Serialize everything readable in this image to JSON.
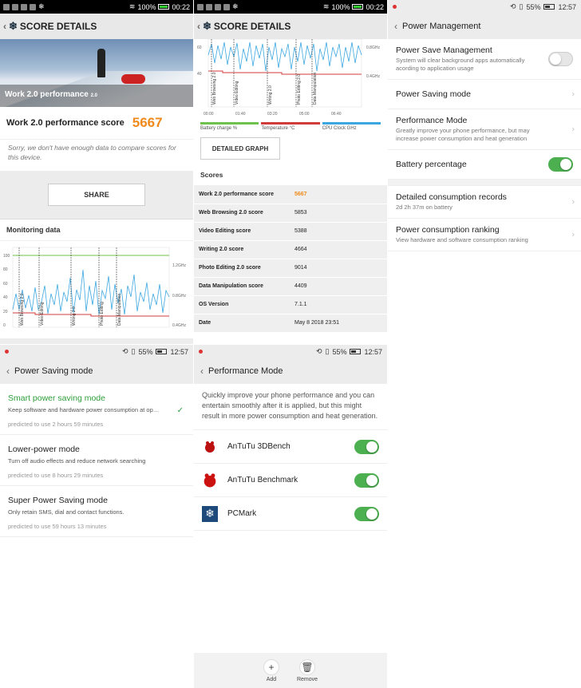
{
  "status_dark": {
    "battery": "100%",
    "time": "00:22"
  },
  "status_light": {
    "battery": "55%",
    "time": "12:57"
  },
  "score_details": {
    "title": "SCORE DETAILS",
    "hero_label": "Work 2.0 performance",
    "hero_label_sub": "2.0",
    "score_label": "Work 2.0 performance score",
    "score_value": "5667",
    "sorry_text": "Sorry, we don't have enough data to compare scores for this device.",
    "share_label": "SHARE",
    "monitoring_title": "Monitoring data",
    "chart_axis_left": [
      "100",
      "80",
      "60",
      "40",
      "20",
      "0"
    ],
    "chart_axis_right": [
      "1.2GHz",
      "0.8GHz",
      "0.4GHz"
    ],
    "chart_markers": [
      "Web Browsing 2.0",
      "Video Editing",
      "Writing 2.0",
      "Photo Editing",
      "Data Manipulation"
    ]
  },
  "score_details2": {
    "title": "SCORE DETAILS",
    "axis_right": [
      "0.8GHz",
      "0.4GHz"
    ],
    "axis_left": [
      "60",
      "40"
    ],
    "markers": [
      "Web Browsing 2.0",
      "Video Editing",
      "Writing 2.0",
      "Photo Editing 2.0",
      "Data Manipulation"
    ],
    "time_ticks": [
      "00:00",
      "01:40",
      "03:20",
      "05:00",
      "06:40"
    ],
    "legend": [
      "Battery charge %",
      "Temperature °C",
      "CPU Clock GHz"
    ],
    "legend_colors": [
      "#6cc24a",
      "#d33b3b",
      "#3ba6e0"
    ],
    "detailed_graph_label": "DETAILED GRAPH",
    "scores_title": "Scores",
    "rows": [
      {
        "k": "Work 2.0 performance score",
        "v": "5667"
      },
      {
        "k": "Web Browsing 2.0 score",
        "v": "5853"
      },
      {
        "k": "Video Editing score",
        "v": "5388"
      },
      {
        "k": "Writing 2.0 score",
        "v": "4664"
      },
      {
        "k": "Photo Editing 2.0 score",
        "v": "9014"
      },
      {
        "k": "Data Manipulation score",
        "v": "4409"
      },
      {
        "k": "OS Version",
        "v": "7.1.1"
      },
      {
        "k": "Date",
        "v": "May 8 2018 23:51"
      }
    ]
  },
  "power_management": {
    "title": "Power Management",
    "items": [
      {
        "title": "Power Save Management",
        "desc": "System will clear background apps automatically acording to application usage"
      },
      {
        "title": "Power Saving mode"
      },
      {
        "title": "Performance Mode",
        "desc": "Greatly improve your phone performance, but may increase power consumption and heat generation"
      },
      {
        "title": "Battery percentage"
      },
      {
        "title": "Detailed consumption records",
        "desc": "2d 2h 37m on battery"
      },
      {
        "title": "Power consumption ranking",
        "desc": "View hardware and software consumption ranking"
      }
    ]
  },
  "power_saving_mode": {
    "title": "Power Saving mode",
    "modes": [
      {
        "title": "Smart power saving mode",
        "desc": "Keep software and hardware power consumption at optimal levels",
        "pred": "predicted to use 2 hours 59 minutes"
      },
      {
        "title": "Lower-power mode",
        "desc": "Turn off audio effects and reduce network searching",
        "pred": "predicted to use 8 hours 29 minutes"
      },
      {
        "title": "Super Power Saving mode",
        "desc": "Only retain SMS, dial and contact functions.",
        "pred": "predicted to use 59 hours 13 minutes"
      }
    ]
  },
  "performance_mode": {
    "title": "Performance Mode",
    "desc": "Quickly improve your phone performance and you can entertain smoothly after it is applied, but this might result in more power consumption and heat generation.",
    "apps": [
      "AnTuTu 3DBench",
      "AnTuTu Benchmark",
      "PCMark"
    ],
    "add_label": "Add",
    "remove_label": "Remove"
  }
}
